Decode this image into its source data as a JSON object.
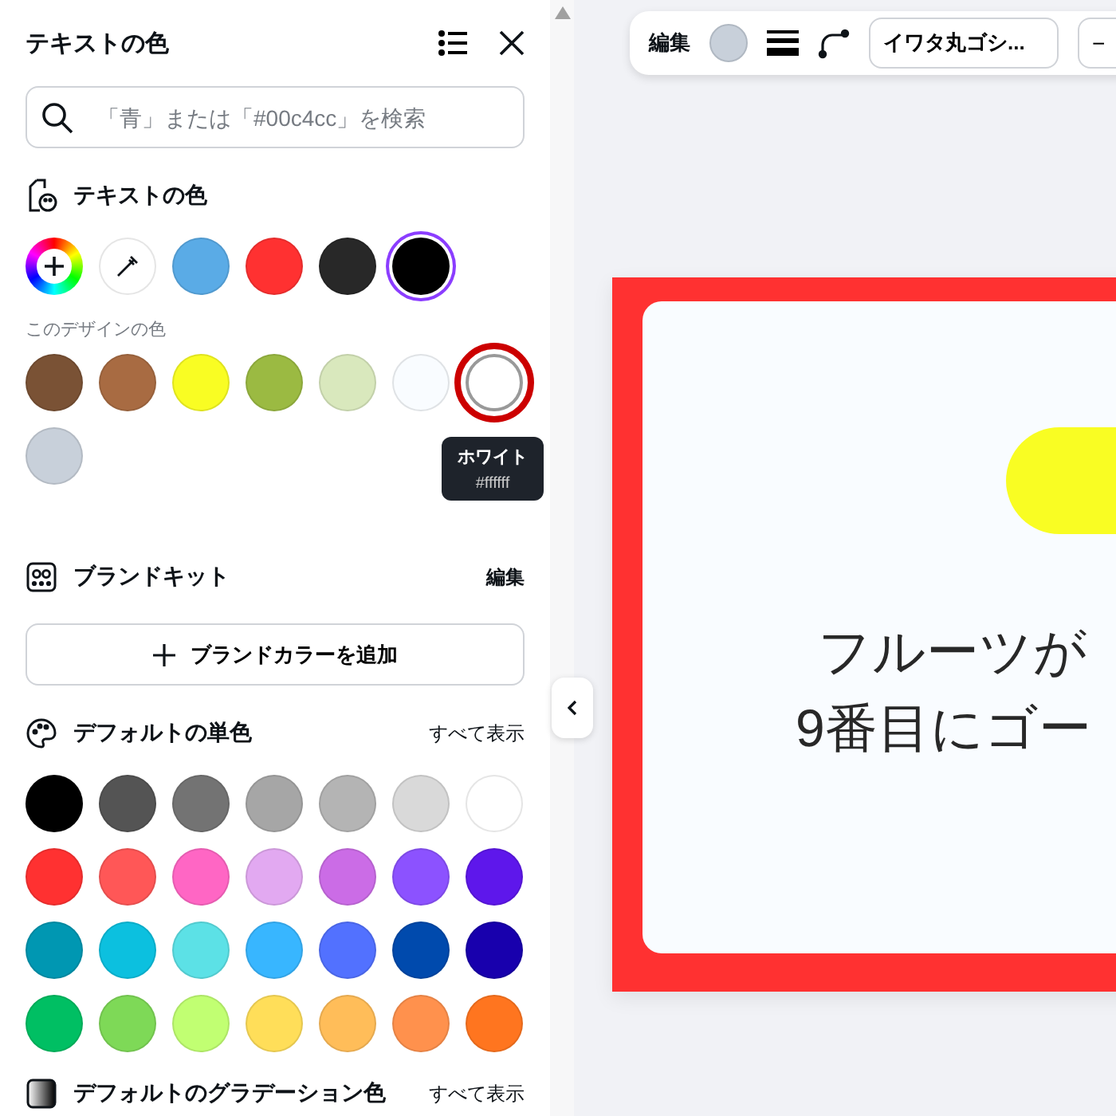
{
  "panel": {
    "title": "テキストの色",
    "search": {
      "placeholder": "「青」または「#00c4cc」を検索"
    },
    "text_colors": {
      "title": "テキストの色",
      "items": [
        {
          "kind": "add",
          "selected": false
        },
        {
          "kind": "eyedropper",
          "selected": false
        },
        {
          "kind": "swatch",
          "color": "#5aabe6",
          "selected": false
        },
        {
          "kind": "swatch",
          "color": "#ff3131",
          "selected": false
        },
        {
          "kind": "swatch",
          "color": "#282828",
          "selected": false
        },
        {
          "kind": "swatch",
          "color": "#000000",
          "selected": true
        }
      ]
    },
    "design_colors": {
      "title": "このデザインの色",
      "items": [
        {
          "color": "#7a5235",
          "highlighted": false
        },
        {
          "color": "#a86b42",
          "highlighted": false
        },
        {
          "color": "#f9fd23",
          "highlighted": false
        },
        {
          "color": "#9bba42",
          "highlighted": false
        },
        {
          "color": "#d9e8bd",
          "highlighted": false
        },
        {
          "color": "#f9fcff",
          "highlighted": false
        },
        {
          "color": "#ffffff",
          "highlighted": true
        },
        {
          "color": "#c8d0da",
          "highlighted": false
        }
      ]
    },
    "tooltip": {
      "name": "ホワイト",
      "hex": "#ffffff"
    },
    "brand_kit": {
      "title": "ブランドキット",
      "action": "編集",
      "add_button": "ブランドカラーを追加"
    },
    "default_solid": {
      "title": "デフォルトの単色",
      "action": "すべて表示",
      "colors": [
        {
          "color": "#000000"
        },
        {
          "color": "#545454"
        },
        {
          "color": "#737373"
        },
        {
          "color": "#a6a6a6"
        },
        {
          "color": "#b4b4b4"
        },
        {
          "color": "#d9d9d9"
        },
        {
          "color": "#ffffff"
        },
        {
          "color": "#ff3131"
        },
        {
          "color": "#ff5757"
        },
        {
          "color": "#ff66c4"
        },
        {
          "color": "#e2a9f1"
        },
        {
          "color": "#cb6ce6"
        },
        {
          "color": "#8c52ff"
        },
        {
          "color": "#5e17eb"
        },
        {
          "color": "#0097b2"
        },
        {
          "color": "#0cc0df"
        },
        {
          "color": "#5ce1e6"
        },
        {
          "color": "#38b6ff"
        },
        {
          "color": "#5271ff"
        },
        {
          "color": "#004aad"
        },
        {
          "color": "#1800ad"
        },
        {
          "color": "#00bf63"
        },
        {
          "color": "#7ed957"
        },
        {
          "color": "#c1ff72"
        },
        {
          "color": "#ffde59"
        },
        {
          "color": "#ffbd59"
        },
        {
          "color": "#ff914d"
        },
        {
          "color": "#ff751f"
        }
      ]
    },
    "default_gradient": {
      "title": "デフォルトのグラデーション色",
      "action": "すべて表示"
    }
  },
  "toolbar": {
    "edit": "編集",
    "color": "#c8d0da",
    "font": "イワタ丸ゴシ...",
    "decrease": "−"
  },
  "design": {
    "lines": [
      "フルーツが",
      "9番目にゴー"
    ]
  }
}
